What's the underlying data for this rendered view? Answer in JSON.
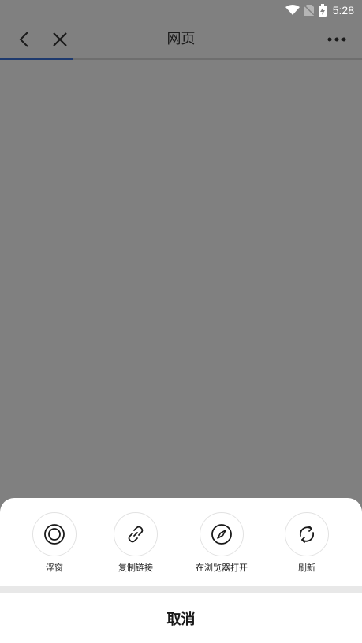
{
  "status_bar": {
    "time": "5:28"
  },
  "toolbar": {
    "title": "网页",
    "progress_percent": 20
  },
  "sheet": {
    "actions": [
      {
        "label": "浮窗",
        "icon": "floating-window-icon"
      },
      {
        "label": "复制链接",
        "icon": "link-icon"
      },
      {
        "label": "在浏览器打开",
        "icon": "compass-icon"
      },
      {
        "label": "刷新",
        "icon": "refresh-icon"
      }
    ],
    "cancel_label": "取消"
  },
  "colors": {
    "overlay": "#808080",
    "progress": "#1e3a6e",
    "sheet": "#ffffff"
  }
}
